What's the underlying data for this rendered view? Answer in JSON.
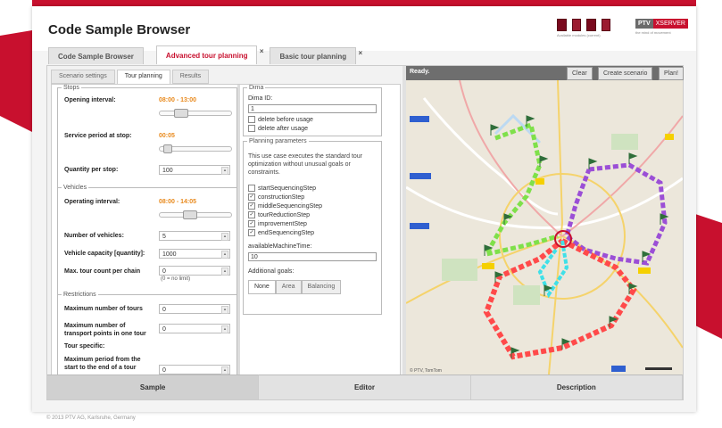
{
  "app": {
    "title": "Code Sample Browser",
    "footer": "© 2013 PTV AG, Karlsruhe, Germany"
  },
  "branding": {
    "modules_caption": "Available modules (current)",
    "logo_ptv": "PTV",
    "logo_xserver": "XSERVER",
    "tagline": "the mind of movement"
  },
  "doc_tabs": [
    {
      "label": "Code Sample Browser",
      "active": false
    },
    {
      "label": "Advanced tour planning",
      "active": true,
      "closable": true
    },
    {
      "label": "Basic tour planning",
      "active": false,
      "closable": true
    }
  ],
  "close_glyph": "×",
  "inner_tabs": [
    "Scenario settings",
    "Tour planning",
    "Results"
  ],
  "stops": {
    "legend": "Stops",
    "opening_interval_label": "Opening interval:",
    "opening_interval_value": "08:00 - 13:00",
    "opening_interval_slider": [
      0.15,
      0.35
    ],
    "service_period_label": "Service period at stop:",
    "service_period_value": "00:05",
    "service_period_slider": 0.05,
    "quantity_label": "Quantity per stop:",
    "quantity_value": "100"
  },
  "vehicles": {
    "legend": "Vehicles",
    "operating_interval_label": "Operating interval:",
    "operating_interval_value": "08:00 - 14:05",
    "operating_interval_slider": [
      0.3,
      0.5
    ],
    "num_vehicles_label": "Number of vehicles:",
    "num_vehicles_value": "5",
    "capacity_label": "Vehicle capacity [quantity]:",
    "capacity_value": "1000",
    "max_tour_label": "Max. tour count per chain",
    "max_tour_value": "0",
    "max_tour_hint": "(0 = no limit)"
  },
  "restrictions": {
    "legend": "Restrictions",
    "max_tours_label": "Maximum number of tours",
    "max_tours_value": "0",
    "max_transport_label": "Maximum number of transport points in one tour",
    "max_transport_value": "0",
    "tour_specific_label": "Tour specific:",
    "max_period_label": "Maximum period from the start to the end of a tour",
    "max_period_value": "0"
  },
  "dima": {
    "legend": "Dima",
    "id_label": "Dima ID:",
    "id_value": "1",
    "delete_before": "delete before usage",
    "delete_after": "delete after usage"
  },
  "planning": {
    "legend": "Planning parameters",
    "description": "This use case executes the standard tour optimization without unusual goals or constraints.",
    "steps": [
      {
        "label": "startSequencingStep",
        "checked": false
      },
      {
        "label": "constructionStep",
        "checked": true
      },
      {
        "label": "middleSequencingStep",
        "checked": true
      },
      {
        "label": "tourReductionStep",
        "checked": true
      },
      {
        "label": "improvementStep",
        "checked": true
      },
      {
        "label": "endSequencingStep",
        "checked": true
      }
    ],
    "machine_time_label": "availableMachineTime:",
    "machine_time_value": "10",
    "goals_label": "Additional goals:",
    "goals": [
      {
        "label": "None",
        "active": true
      },
      {
        "label": "Area",
        "active": false
      },
      {
        "label": "Balancing",
        "active": false
      }
    ]
  },
  "map": {
    "status": "Ready.",
    "buttons": [
      "Clear",
      "Create scenario",
      "Plan!"
    ],
    "copyright": "© PTV, TomTom",
    "route_colors": [
      "#7fe04a",
      "#9b4fd6",
      "#ff4a4a",
      "#3fe0e8"
    ]
  },
  "bottom_tabs": [
    {
      "label": "Sample",
      "active": true
    },
    {
      "label": "Editor",
      "active": false
    },
    {
      "label": "Description",
      "active": false
    }
  ]
}
